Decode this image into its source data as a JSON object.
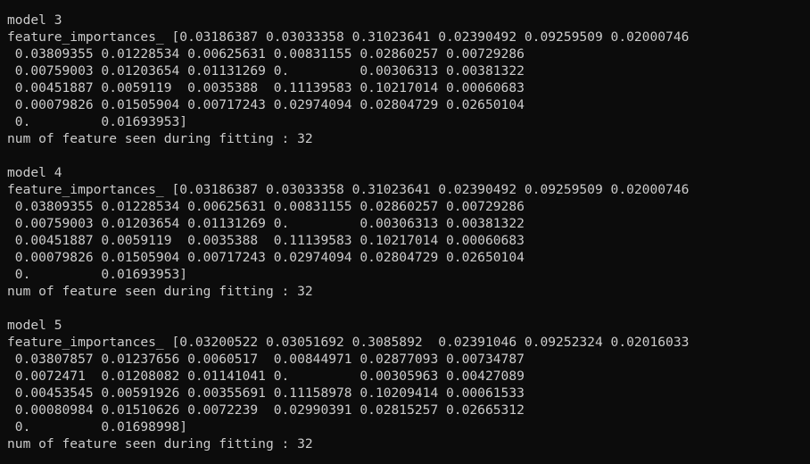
{
  "terminal": {
    "blocks": [
      {
        "model_label": "model 3",
        "importance_lines": [
          "feature_importances_ [0.03186387 0.03033358 0.31023641 0.02390492 0.09259509 0.02000746",
          " 0.03809355 0.01228534 0.00625631 0.00831155 0.02860257 0.00729286",
          " 0.00759003 0.01203654 0.01131269 0.         0.00306313 0.00381322",
          " 0.00451887 0.0059119  0.0035388  0.11139583 0.10217014 0.00060683",
          " 0.00079826 0.01505904 0.00717243 0.02974094 0.02804729 0.02650104",
          " 0.         0.01693953]"
        ],
        "feature_count_line": "num of feature seen during fitting : 32"
      },
      {
        "model_label": "model 4",
        "importance_lines": [
          "feature_importances_ [0.03186387 0.03033358 0.31023641 0.02390492 0.09259509 0.02000746",
          " 0.03809355 0.01228534 0.00625631 0.00831155 0.02860257 0.00729286",
          " 0.00759003 0.01203654 0.01131269 0.         0.00306313 0.00381322",
          " 0.00451887 0.0059119  0.0035388  0.11139583 0.10217014 0.00060683",
          " 0.00079826 0.01505904 0.00717243 0.02974094 0.02804729 0.02650104",
          " 0.         0.01693953]"
        ],
        "feature_count_line": "num of feature seen during fitting : 32"
      },
      {
        "model_label": "model 5",
        "importance_lines": [
          "feature_importances_ [0.03200522 0.03051692 0.3085892  0.02391046 0.09252324 0.02016033",
          " 0.03807857 0.01237656 0.0060517  0.00844971 0.02877093 0.00734787",
          " 0.0072471  0.01208082 0.01141041 0.         0.00305963 0.00427089",
          " 0.00453545 0.00591926 0.00355691 0.11158978 0.10209414 0.00061533",
          " 0.00080984 0.01510626 0.0072239  0.02990391 0.02815257 0.02665312",
          " 0.         0.01698998]"
        ],
        "feature_count_line": "num of feature seen during fitting : 32"
      }
    ],
    "colors": {
      "background": "#0c0c0c",
      "text": "#cccccc"
    }
  }
}
